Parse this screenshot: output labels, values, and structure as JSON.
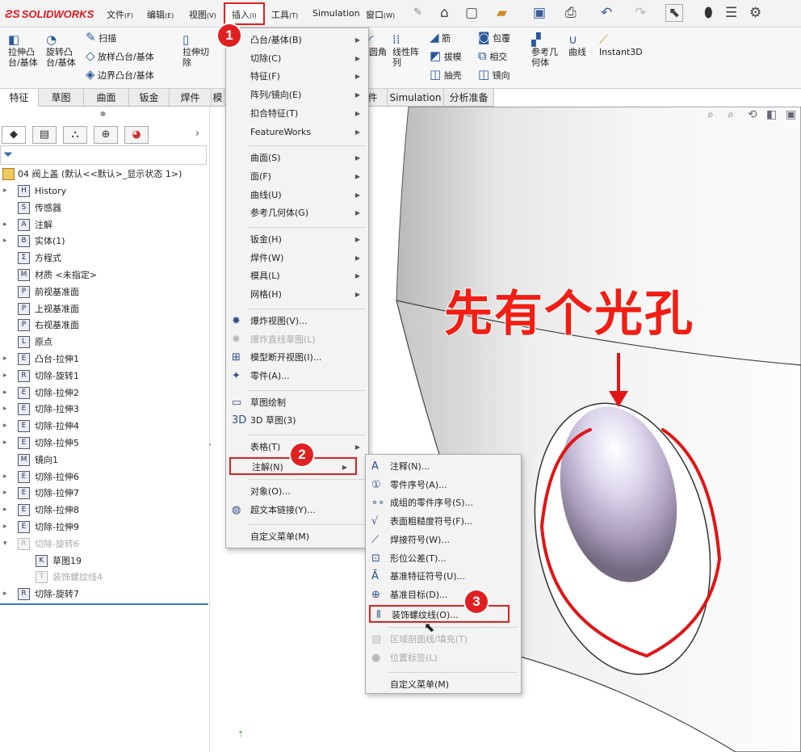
{
  "app": {
    "logo": "SOLIDWORKS"
  },
  "menubar": [
    {
      "label": "文件",
      "key": "(F)"
    },
    {
      "label": "编辑",
      "key": "(E)"
    },
    {
      "label": "视图",
      "key": "(V)"
    },
    {
      "label": "插入",
      "key": "(I)"
    },
    {
      "label": "工具",
      "key": "(T)"
    },
    {
      "label": "Simulation",
      "key": ""
    },
    {
      "label": "窗口",
      "key": "(W)"
    }
  ],
  "ribbon": {
    "extrude_boss": "拉伸凸\n台/基体",
    "revolve_boss": "旋转凸\n台/基体",
    "sweep": "扫描",
    "loft": "放样凸台/基体",
    "boundary": "边界凸台/基体",
    "extrude_cut": "拉伸切\n除",
    "fillet": "圆角",
    "linear_pattern": "线性阵\n列",
    "rib": "筋",
    "draft": "拔模",
    "shell": "抽壳",
    "wrap": "包覆",
    "intersect": "相交",
    "mirror": "镜向",
    "ref_geometry": "参考几\n何体",
    "curves": "曲线",
    "instant3d": "Instant3D"
  },
  "tabs": [
    "特征",
    "草图",
    "曲面",
    "钣金",
    "焊件",
    "模",
    "件",
    "Simulation",
    "分析准备"
  ],
  "tree": {
    "root": "04 阀上盖 (默认<<默认>_显示状态 1>)",
    "items": [
      {
        "label": "History",
        "twisty": "▸",
        "icon": "H",
        "dim": false
      },
      {
        "label": "传感器",
        "twisty": "",
        "icon": "S",
        "dim": false
      },
      {
        "label": "注解",
        "twisty": "▸",
        "icon": "A",
        "dim": false
      },
      {
        "label": "实体(1)",
        "twisty": "▸",
        "icon": "B",
        "dim": false
      },
      {
        "label": "方程式",
        "twisty": "",
        "icon": "Σ",
        "dim": false
      },
      {
        "label": "材质 <未指定>",
        "twisty": "",
        "icon": "M",
        "dim": false
      },
      {
        "label": "前视基准面",
        "twisty": "",
        "icon": "P",
        "dim": false
      },
      {
        "label": "上视基准面",
        "twisty": "",
        "icon": "P",
        "dim": false
      },
      {
        "label": "右视基准面",
        "twisty": "",
        "icon": "P",
        "dim": false
      },
      {
        "label": "原点",
        "twisty": "",
        "icon": "L",
        "dim": false
      },
      {
        "label": "凸台-拉伸1",
        "twisty": "▸",
        "icon": "E",
        "dim": false
      },
      {
        "label": "切除-旋转1",
        "twisty": "▸",
        "icon": "R",
        "dim": false
      },
      {
        "label": "切除-拉伸2",
        "twisty": "▸",
        "icon": "E",
        "dim": false
      },
      {
        "label": "切除-拉伸3",
        "twisty": "▸",
        "icon": "E",
        "dim": false
      },
      {
        "label": "切除-拉伸4",
        "twisty": "▸",
        "icon": "E",
        "dim": false
      },
      {
        "label": "切除-拉伸5",
        "twisty": "▸",
        "icon": "E",
        "dim": false
      },
      {
        "label": "镜向1",
        "twisty": "",
        "icon": "M",
        "dim": false
      },
      {
        "label": "切除-拉伸6",
        "twisty": "▸",
        "icon": "E",
        "dim": false
      },
      {
        "label": "切除-拉伸7",
        "twisty": "▸",
        "icon": "E",
        "dim": false
      },
      {
        "label": "切除-拉伸8",
        "twisty": "▸",
        "icon": "E",
        "dim": false
      },
      {
        "label": "切除-拉伸9",
        "twisty": "▸",
        "icon": "E",
        "dim": false
      },
      {
        "label": "切除-旋转6",
        "twisty": "▾",
        "icon": "R",
        "dim": true
      },
      {
        "label": "草图19",
        "twisty": "",
        "icon": "K",
        "dim": false,
        "indent": true
      },
      {
        "label": "装饰螺纹线4",
        "twisty": "",
        "icon": "T",
        "dim": true,
        "indent": true
      },
      {
        "label": "切除-旋转7",
        "twisty": "▸",
        "icon": "R",
        "dim": false
      }
    ]
  },
  "insert_menu": [
    {
      "label": "凸台/基体(B)",
      "sub": true
    },
    {
      "label": "切除(C)",
      "sub": true
    },
    {
      "label": "特征(F)",
      "sub": true
    },
    {
      "label": "阵列/镜向(E)",
      "sub": true
    },
    {
      "label": "扣合特征(T)",
      "sub": true
    },
    {
      "label": "FeatureWorks",
      "sub": true
    },
    {
      "sep": true
    },
    {
      "label": "曲面(S)",
      "sub": true
    },
    {
      "label": "面(F)",
      "sub": true
    },
    {
      "label": "曲线(U)",
      "sub": true
    },
    {
      "label": "参考几何体(G)",
      "sub": true
    },
    {
      "sep": true
    },
    {
      "label": "钣金(H)",
      "sub": true
    },
    {
      "label": "焊件(W)",
      "sub": true
    },
    {
      "label": "模具(L)",
      "sub": true
    },
    {
      "label": "网格(H)",
      "sub": true
    },
    {
      "sep": true
    },
    {
      "label": "爆炸视图(V)...",
      "icon": "✸"
    },
    {
      "label": "爆炸直线草图(L)",
      "icon": "✸",
      "dim": true
    },
    {
      "label": "模型断开视图(I)...",
      "icon": "⊞"
    },
    {
      "label": "零件(A)...",
      "icon": "✦"
    },
    {
      "sep": true
    },
    {
      "label": "草图绘制",
      "icon": "▭"
    },
    {
      "label": "3D 草图(3)",
      "icon": "3D"
    },
    {
      "sep": true
    },
    {
      "label": "表格(T)",
      "sub": true
    },
    {
      "label": "注解(N)",
      "sub": true,
      "highlight": true
    },
    {
      "sep": true
    },
    {
      "label": "对象(O)...",
      "icon": ""
    },
    {
      "label": "超文本链接(Y)...",
      "icon": "◍"
    },
    {
      "sep": true
    },
    {
      "label": "自定义菜单(M)",
      "icon": ""
    }
  ],
  "annotation_menu": [
    {
      "label": "注释(N)...",
      "icon": "A"
    },
    {
      "label": "零件序号(A)...",
      "icon": "①"
    },
    {
      "label": "成组的零件序号(S)...",
      "icon": "∘∘"
    },
    {
      "label": "表面粗糙度符号(F)...",
      "icon": "√"
    },
    {
      "label": "焊接符号(W)...",
      "icon": "⟋"
    },
    {
      "label": "形位公差(T)...",
      "icon": "⊡"
    },
    {
      "label": "基准特征符号(U)...",
      "icon": "Ā"
    },
    {
      "label": "基准目标(D)...",
      "icon": "⊕"
    },
    {
      "label": "装饰螺纹线(O)...",
      "icon": "⦀",
      "highlight": true
    },
    {
      "sep": true
    },
    {
      "label": "区域剖面线/填充(T)",
      "icon": "▨",
      "dim": true
    },
    {
      "label": "位置标签(L)",
      "icon": "●",
      "dim": true
    },
    {
      "sep": true
    },
    {
      "label": "自定义菜单(M)",
      "icon": ""
    }
  ],
  "badges": [
    "1",
    "2",
    "3"
  ],
  "annotation_text": "先有个光孔",
  "colors": {
    "accent": "#e02020",
    "annotation": "#f01e14",
    "logo": "#d71920"
  }
}
